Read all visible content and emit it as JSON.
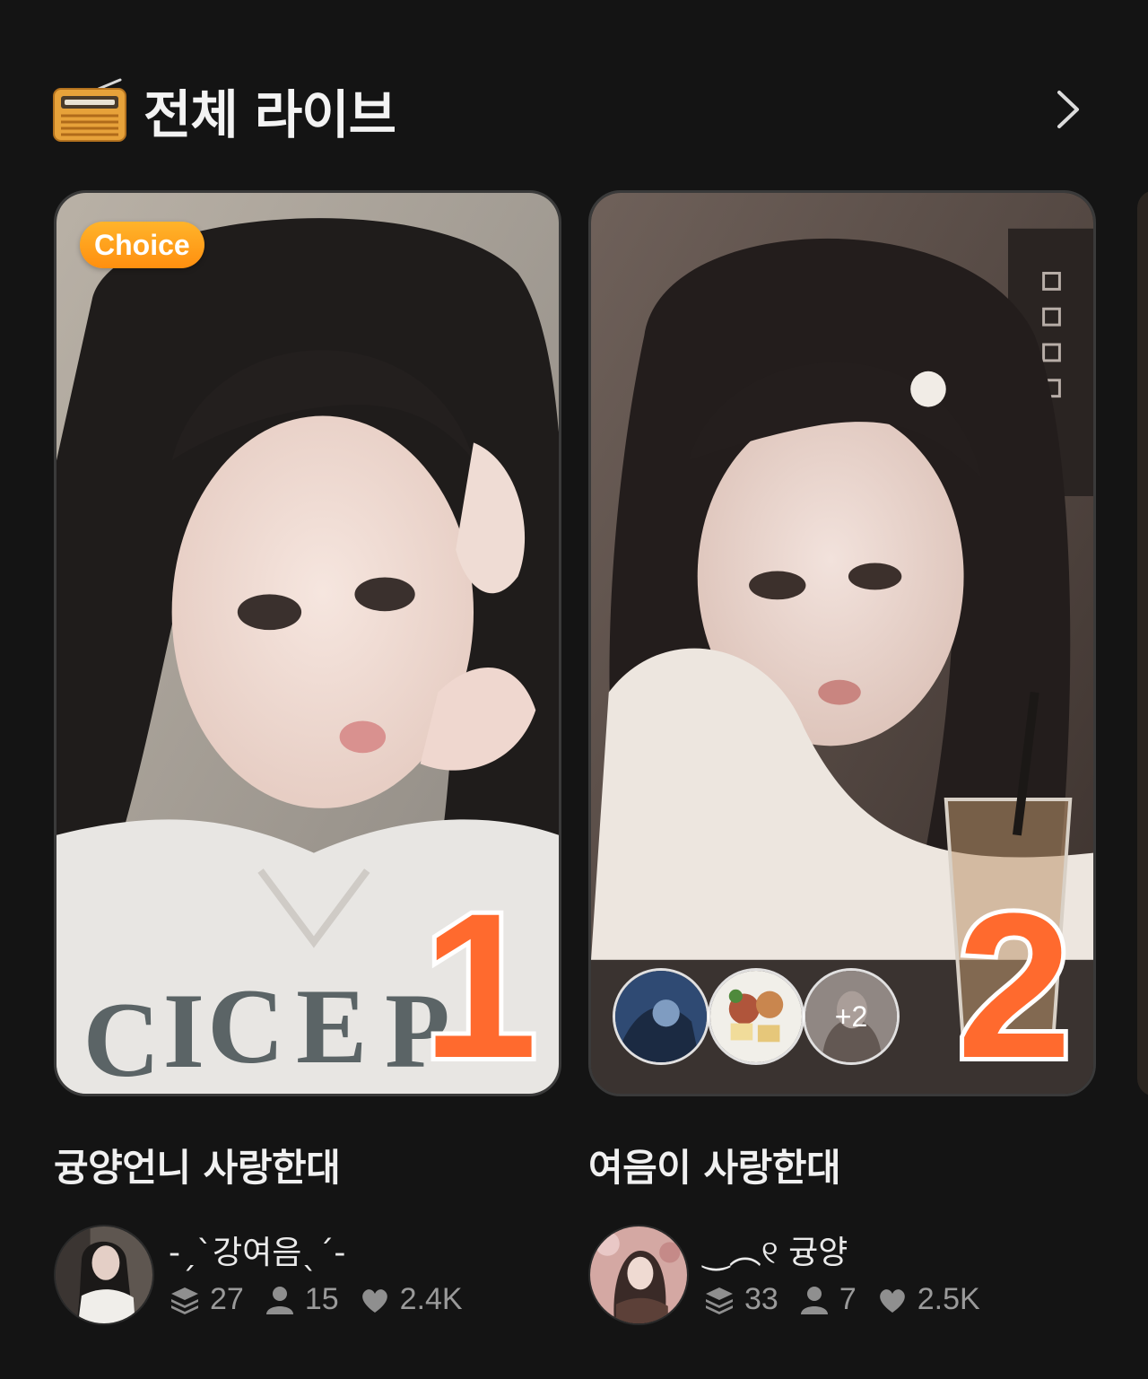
{
  "header": {
    "title": "전체 라이브",
    "icon": "radio-icon",
    "more_icon": "chevron-right-icon"
  },
  "cards": [
    {
      "badge": "Choice",
      "rank": "1",
      "title": "귱양언니 사랑한대",
      "host_name": "-ˏˋ강여음ˎˊ-",
      "stats": {
        "layers": "27",
        "listeners": "15",
        "likes": "2.4K"
      }
    },
    {
      "rank": "2",
      "participants_more": "+2",
      "title": "여음이 사랑한대",
      "host_name": "‿︵୧ 귱양",
      "stats": {
        "layers": "33",
        "listeners": "7",
        "likes": "2.5K"
      }
    }
  ],
  "colors": {
    "background": "#141414",
    "rank": "#ff6a2e",
    "badge": "#ff9a1a",
    "muted": "#9a9a9a"
  }
}
